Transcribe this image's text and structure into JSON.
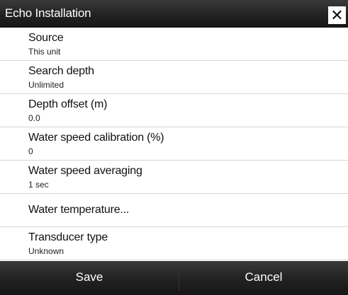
{
  "dialog": {
    "title": "Echo Installation",
    "close_icon": "✕"
  },
  "items": [
    {
      "label": "Source",
      "value": "This unit"
    },
    {
      "label": "Search depth",
      "value": "Unlimited"
    },
    {
      "label": "Depth offset (m)",
      "value": "0.0"
    },
    {
      "label": "Water speed calibration (%)",
      "value": "0"
    },
    {
      "label": "Water speed averaging",
      "value": "1 sec"
    },
    {
      "label": "Water temperature...",
      "value": ""
    },
    {
      "label": "Transducer type",
      "value": "Unknown"
    }
  ],
  "footer": {
    "save_label": "Save",
    "cancel_label": "Cancel"
  }
}
